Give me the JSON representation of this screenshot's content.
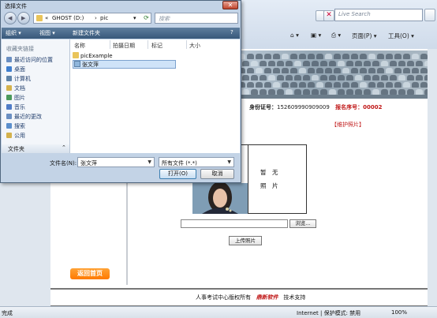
{
  "dialog": {
    "title": "选择文件",
    "path": [
      "GHOST (D:)",
      "pic"
    ],
    "path_prefix": "«",
    "path_sep": "›",
    "search_placeholder": "搜索",
    "toolbar": {
      "organize": "组织 ▾",
      "views": "视图 ▾",
      "new_folder": "新建文件夹"
    },
    "favorites_header": "收藏夹链接",
    "favorites": [
      {
        "label": "最近访问的位置",
        "color": "#6a8fc2"
      },
      {
        "label": "桌面",
        "color": "#3f7fcf"
      },
      {
        "label": "计算机",
        "color": "#5e83a8"
      },
      {
        "label": "文档",
        "color": "#d4b24d"
      },
      {
        "label": "图片",
        "color": "#4b9a5c"
      },
      {
        "label": "音乐",
        "color": "#4f7cc7"
      },
      {
        "label": "最近的更改",
        "color": "#6a8fc2"
      },
      {
        "label": "搜索",
        "color": "#5b8fcd"
      },
      {
        "label": "公用",
        "color": "#d4b24d"
      }
    ],
    "folders_label": "文件夹",
    "columns": [
      "名称",
      "拍摄日期",
      "标记",
      "大小"
    ],
    "files": [
      {
        "name": "picExample",
        "kind": "folder"
      },
      {
        "name": "张文萍",
        "kind": "image",
        "selected": true
      }
    ],
    "filename_label": "文件名(N):",
    "filename_value": "张文萍",
    "filetype_value": "所有文件 (*.*)",
    "open_label": "打开(O)",
    "cancel_label": "取消",
    "close_glyph": "✕"
  },
  "browser": {
    "search_placeholder": "Live Search",
    "toolbar": {
      "page": "页面(P) ▾",
      "tools": "工具(O) ▾"
    },
    "status_text": "完成",
    "status_zone": "Internet | 保护模式: 禁用",
    "zoom": "100%"
  },
  "page": {
    "id_label": "身份证号：",
    "id_value": "152609990909009",
    "reg_label": "报名序号：",
    "reg_value": "00002",
    "maintain_link": "【维护照片】",
    "no_photo_line1": "暂　无",
    "no_photo_line2": "照　片",
    "browse_label": "浏览...",
    "upload_label": "上传照片",
    "back_label": "返回首页",
    "footer_text": "人事考试中心版权所有",
    "footer_logo": "鼎新软件",
    "footer_support": "技术支持"
  }
}
